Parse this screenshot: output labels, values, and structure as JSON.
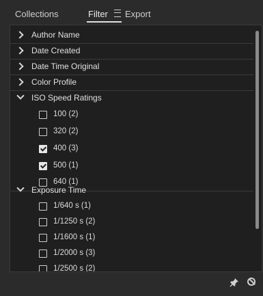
{
  "tabs": {
    "collections_label": "Collections",
    "filter_label": "Filter",
    "export_label": "Export",
    "active": "Filter"
  },
  "groups": [
    {
      "label": "Author Name",
      "expanded": false
    },
    {
      "label": "Date Created",
      "expanded": false
    },
    {
      "label": "Date Time Original",
      "expanded": false
    },
    {
      "label": "Color Profile",
      "expanded": false
    },
    {
      "label": "ISO Speed Ratings",
      "expanded": true
    },
    {
      "label": "Exposure Time",
      "expanded": true
    }
  ],
  "iso_items": [
    {
      "label": "100  (2)",
      "checked": false
    },
    {
      "label": "320  (2)",
      "checked": false
    },
    {
      "label": "400  (3)",
      "checked": true
    },
    {
      "label": "500  (1)",
      "checked": true
    },
    {
      "label": "640  (1)",
      "checked": false
    }
  ],
  "exposure_items": [
    {
      "label": "1/640 s  (1)",
      "checked": false
    },
    {
      "label": "1/1250 s  (2)",
      "checked": false
    },
    {
      "label": "1/1600 s  (1)",
      "checked": false
    },
    {
      "label": "1/2000 s  (3)",
      "checked": false
    },
    {
      "label": "1/2500 s  (2)",
      "checked": false
    }
  ],
  "icons": {
    "filter_menu": "hamburger-icon",
    "pin": "pin-icon",
    "clear": "no-symbol-icon",
    "collapsed": "chevron-right-icon",
    "expanded": "chevron-down-icon"
  }
}
